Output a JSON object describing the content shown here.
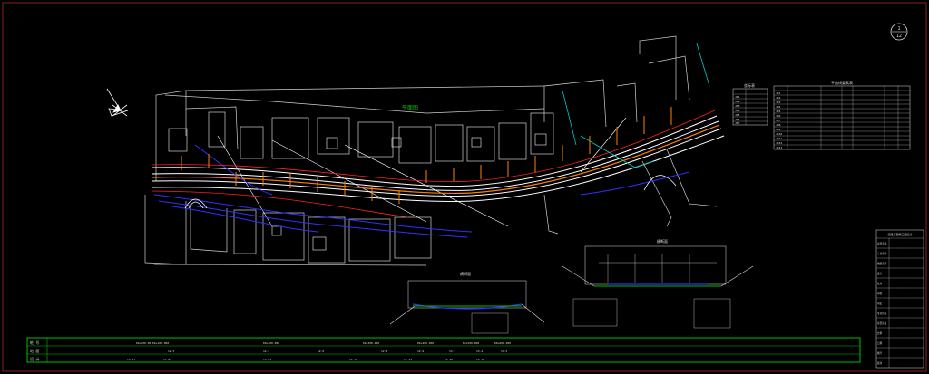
{
  "sheet": {
    "page_mark_top": "1",
    "page_mark_bottom": "12"
  },
  "plan_title": "平面图",
  "section_a_title": "横断面",
  "section_b_title": "横断面",
  "colors": {
    "background": "#000000",
    "frame": "#e0e0e0",
    "road_line": "#ffffff",
    "centerline": "#ff8000",
    "river": "#3030ff",
    "title_green": "#00c000",
    "label_cyan": "#00cccc",
    "red_line": "#ff2020",
    "grid_green": "#00ff00"
  },
  "station_strip": {
    "rows": [
      {
        "label": "桩 号",
        "values": [
          "K0+000.00 K0+100.000",
          "K0+200.000",
          "K0+300.000",
          "K0+400.000",
          "K0+500.000",
          "K0+600.000"
        ]
      },
      {
        "label": "地 面",
        "values": [
          "12.3",
          "12.4",
          "12.6",
          "12.8",
          "12.9",
          "13.1",
          "13.4",
          "13.5"
        ]
      },
      {
        "label": "设 计",
        "values": [
          "12.71",
          "12.84",
          "12.97",
          "13.10",
          "13.23",
          "13.36",
          "13.49"
        ]
      }
    ]
  },
  "coord_table": {
    "title": "坐标表",
    "rows": [
      "JD1",
      "JD2",
      "JD3",
      "JD4",
      "JD5",
      "JD6",
      "JD7"
    ]
  },
  "curve_table": {
    "title": "平曲线要素表",
    "rows": [
      "JD1",
      "JD2",
      "JD3",
      "JD4",
      "JD5",
      "JD6",
      "JD7",
      "JD8",
      "JD9",
      "JD10",
      "JD11",
      "JD12",
      "JD13"
    ]
  },
  "title_block": {
    "heading": "道路工程施工图设计",
    "rows": [
      "项目名称",
      "子项名称",
      "图纸名称",
      "设计",
      "校对",
      "审核",
      "审定",
      "专业负责",
      "项目负责",
      "比例",
      "日期",
      "图号",
      "版次"
    ]
  }
}
